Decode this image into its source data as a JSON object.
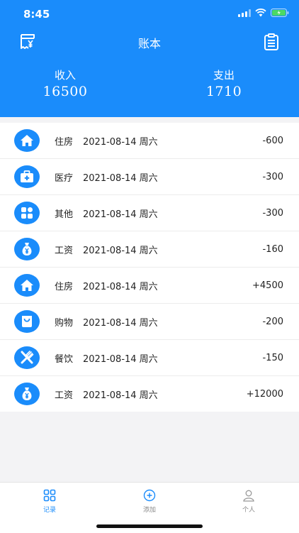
{
  "status_bar": {
    "time": "8:45"
  },
  "nav": {
    "title": "账本",
    "left_icon": "receipt-yen-icon",
    "right_icon": "clipboard-icon"
  },
  "summary": {
    "income_label": "收入",
    "income_value": "16500",
    "expense_label": "支出",
    "expense_value": "1710"
  },
  "records": [
    {
      "icon": "house-icon",
      "category": "住房",
      "date": "2021-08-14 周六",
      "amount": "-600"
    },
    {
      "icon": "medical-kit-icon",
      "category": "医疗",
      "date": "2021-08-14 周六",
      "amount": "-300"
    },
    {
      "icon": "grid-icon",
      "category": "其他",
      "date": "2021-08-14 周六",
      "amount": "-300"
    },
    {
      "icon": "money-bag-icon",
      "category": "工资",
      "date": "2021-08-14 周六",
      "amount": "-160"
    },
    {
      "icon": "house-icon",
      "category": "住房",
      "date": "2021-08-14 周六",
      "amount": "+4500"
    },
    {
      "icon": "shopping-bag-icon",
      "category": "购物",
      "date": "2021-08-14 周六",
      "amount": "-200"
    },
    {
      "icon": "utensils-icon",
      "category": "餐饮",
      "date": "2021-08-14 周六",
      "amount": "-150"
    },
    {
      "icon": "money-bag-icon",
      "category": "工资",
      "date": "2021-08-14 周六",
      "amount": "+12000"
    }
  ],
  "tabs": [
    {
      "label": "记录",
      "icon": "grid-icon",
      "active": true
    },
    {
      "label": "添加",
      "icon": "plus-circle-icon",
      "active": false
    },
    {
      "label": "个人",
      "icon": "person-icon",
      "active": false
    }
  ],
  "colors": {
    "accent": "#1a8cfb",
    "background": "#f3f3f5"
  }
}
